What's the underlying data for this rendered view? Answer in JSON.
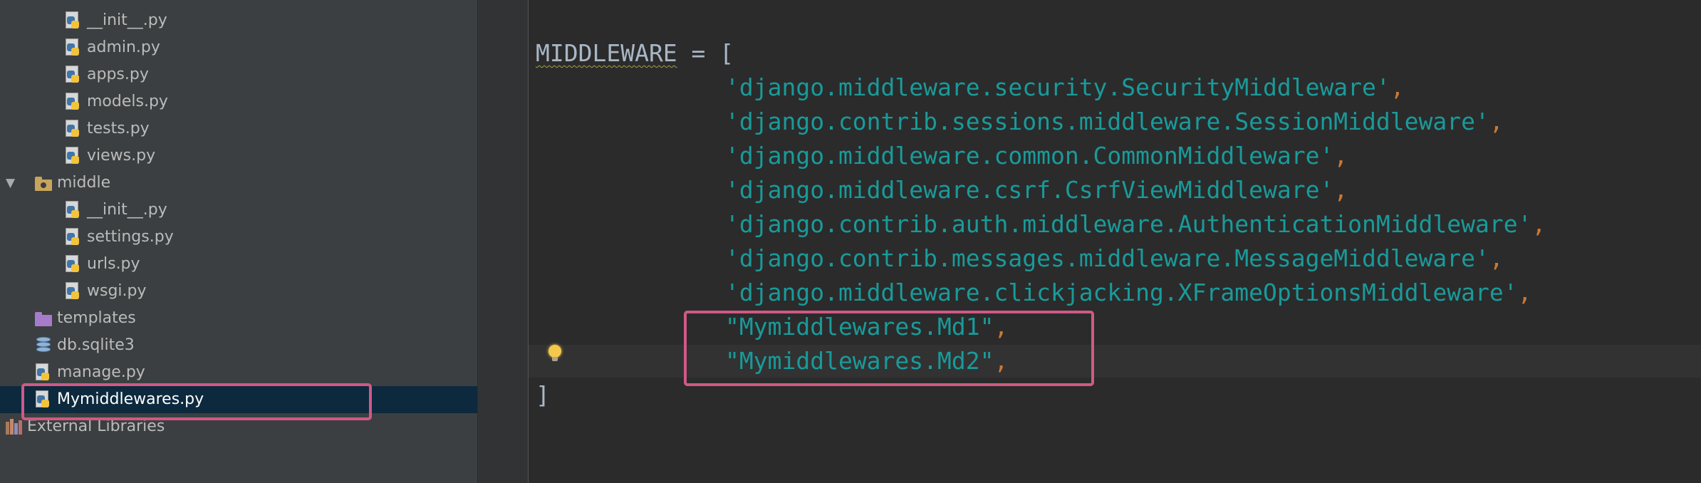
{
  "tree": {
    "items": [
      {
        "label": "__init__.py",
        "icon": "python-file-icon"
      },
      {
        "label": "admin.py",
        "icon": "python-file-icon"
      },
      {
        "label": "apps.py",
        "icon": "python-file-icon"
      },
      {
        "label": "models.py",
        "icon": "python-file-icon"
      },
      {
        "label": "tests.py",
        "icon": "python-file-icon"
      },
      {
        "label": "views.py",
        "icon": "python-file-icon"
      },
      {
        "label": "middle",
        "icon": "package-folder-icon",
        "expanded": true
      },
      {
        "label": "__init__.py",
        "icon": "python-file-icon"
      },
      {
        "label": "settings.py",
        "icon": "python-file-icon"
      },
      {
        "label": "urls.py",
        "icon": "python-file-icon"
      },
      {
        "label": "wsgi.py",
        "icon": "python-file-icon"
      },
      {
        "label": "templates",
        "icon": "templates-folder-icon"
      },
      {
        "label": "db.sqlite3",
        "icon": "database-icon"
      },
      {
        "label": "manage.py",
        "icon": "python-file-icon"
      },
      {
        "label": "Mymiddlewares.py",
        "icon": "python-file-icon",
        "selected": true
      },
      {
        "label": "External Libraries",
        "icon": "libraries-icon"
      }
    ]
  },
  "editor": {
    "open": {
      "ident": "MIDDLEWARE",
      "op": " = ",
      "bracket": "["
    },
    "entries": [
      {
        "text": "'django.middleware.security.SecurityMiddleware'",
        "comma": ","
      },
      {
        "text": "'django.contrib.sessions.middleware.SessionMiddleware'",
        "comma": ","
      },
      {
        "text": "'django.middleware.common.CommonMiddleware'",
        "comma": ","
      },
      {
        "text": "'django.middleware.csrf.CsrfViewMiddleware'",
        "comma": ","
      },
      {
        "text": "'django.contrib.auth.middleware.AuthenticationMiddleware'",
        "comma": ","
      },
      {
        "text": "'django.contrib.messages.middleware.MessageMiddleware'",
        "comma": ","
      },
      {
        "text": "'django.middleware.clickjacking.XFrameOptionsMiddleware'",
        "comma": ","
      },
      {
        "text": "\"Mymiddlewares.Md1\"",
        "comma": ","
      },
      {
        "text": "\"Mymiddlewares.Md2\"",
        "comma": ","
      }
    ],
    "close": "]"
  },
  "colors": {
    "string": "#1a9a9a",
    "punctuation": "#cc7832",
    "highlight": "#cf5a85",
    "selection": "#0d293e"
  }
}
